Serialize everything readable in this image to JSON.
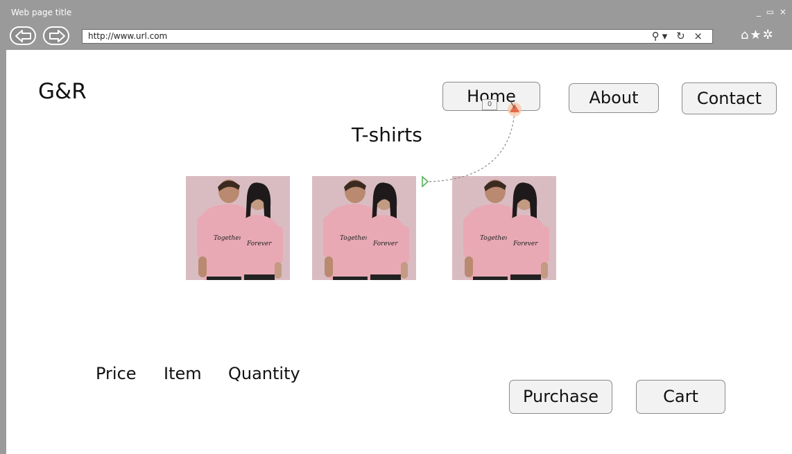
{
  "browser": {
    "window_title": "Web page title",
    "window_controls": "_ ▭ ×",
    "url": "http://www.url.com",
    "url_icons": "⚲▾ ↻ ×",
    "toolbar_icons": "⌂★✲"
  },
  "site": {
    "logo": "G&R",
    "nav": {
      "home": "Home",
      "about": "About",
      "contact": "Contact"
    },
    "heading": "T-shirts",
    "products": [
      {
        "shirt_text_1": "Together",
        "shirt_text_2": "Forever"
      },
      {
        "shirt_text_1": "Together",
        "shirt_text_2": "Forever"
      },
      {
        "shirt_text_1": "Together",
        "shirt_text_2": "Forever"
      }
    ],
    "labels": {
      "price": "Price",
      "item": "Item",
      "quantity": "Quantity"
    },
    "actions": {
      "purchase": "Purchase",
      "cart": "Cart"
    },
    "link_badge": "0"
  },
  "colors": {
    "chrome": "#9a9a9a",
    "shirt_pink": "#e8a9b4",
    "photo_bg": "#d9bcc2",
    "link_arrow": "#e05a3a",
    "link_start": "#4caf50"
  }
}
